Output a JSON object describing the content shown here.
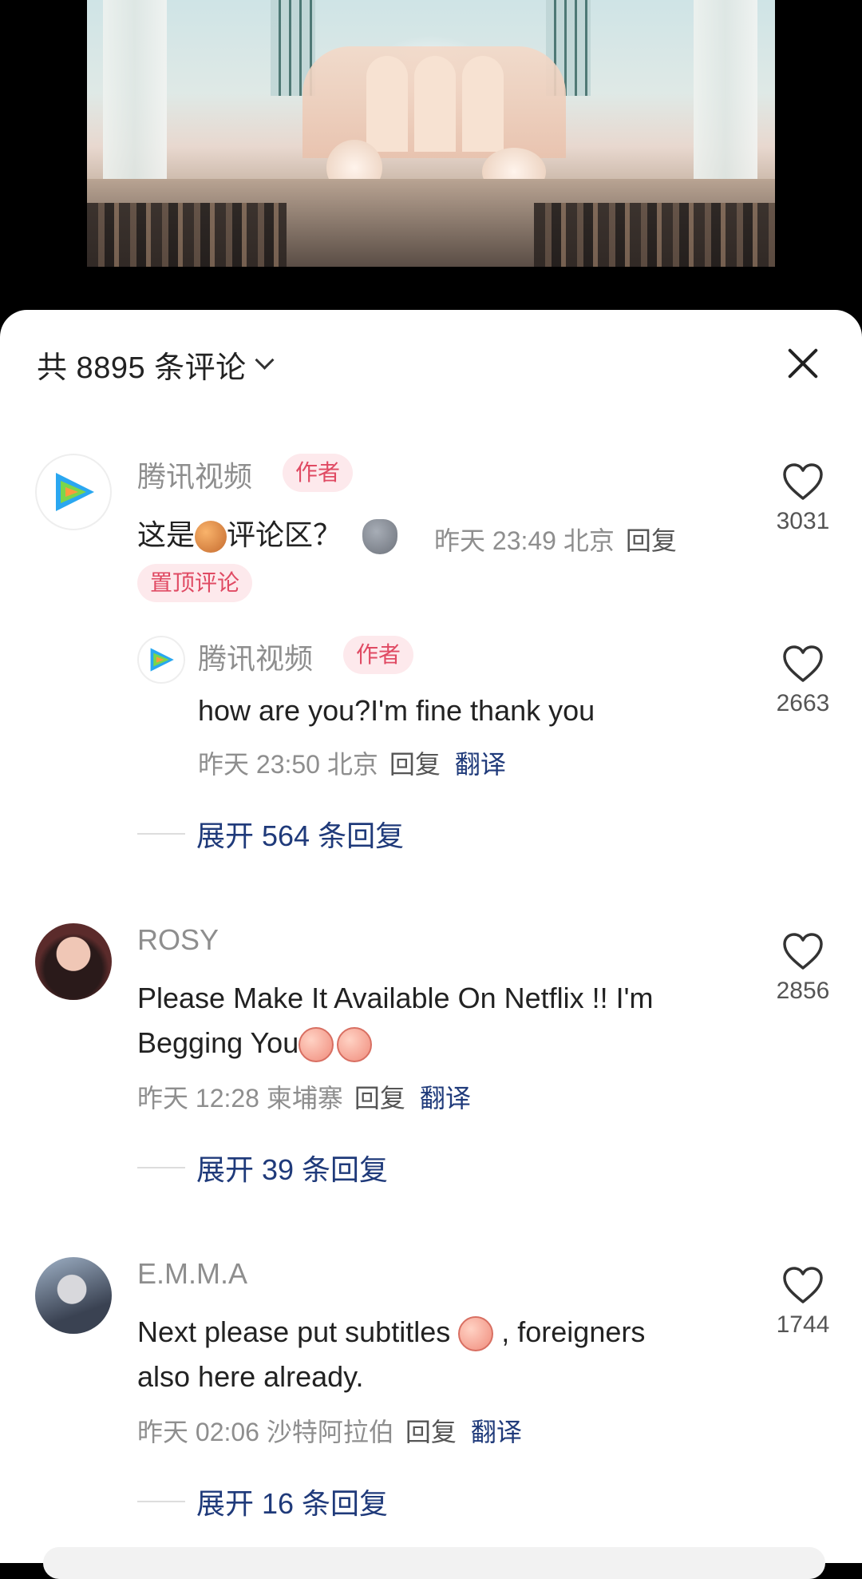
{
  "header": {
    "title": "共 8895 条评论"
  },
  "comments": [
    {
      "name": "腾讯视频",
      "badge": "作者",
      "text_before": "这是",
      "text_after": "评论区？",
      "time": "昨天 23:49 北京",
      "reply_label": "回复",
      "pinned_label": "置顶评论",
      "likes": "3031"
    },
    {
      "name": "腾讯视频",
      "badge": "作者",
      "text": "how are you?I'm fine thank you",
      "time": "昨天 23:50 北京",
      "reply_label": "回复",
      "translate_label": "翻译",
      "likes": "2663"
    },
    {
      "name": "ROSY",
      "text_line1": "Please Make It Available On Netflix !! I'm",
      "text_line2": "Begging You",
      "time": "昨天 12:28 柬埔寨",
      "reply_label": "回复",
      "translate_label": "翻译",
      "likes": "2856"
    },
    {
      "name": "E.M.M.A",
      "text_line1_a": "Next please put subtitles",
      "text_line1_b": ", foreigners",
      "text_line2": "also here already.",
      "time": "昨天 02:06 沙特阿拉伯",
      "reply_label": "回复",
      "translate_label": "翻译",
      "likes": "1744"
    }
  ],
  "expand": [
    "展开 564 条回复",
    "展开 39 条回复",
    "展开 16 条回复"
  ],
  "icons": {
    "heart": "heart-outline-icon",
    "close": "close-icon",
    "chevron": "chevron-down-icon"
  }
}
